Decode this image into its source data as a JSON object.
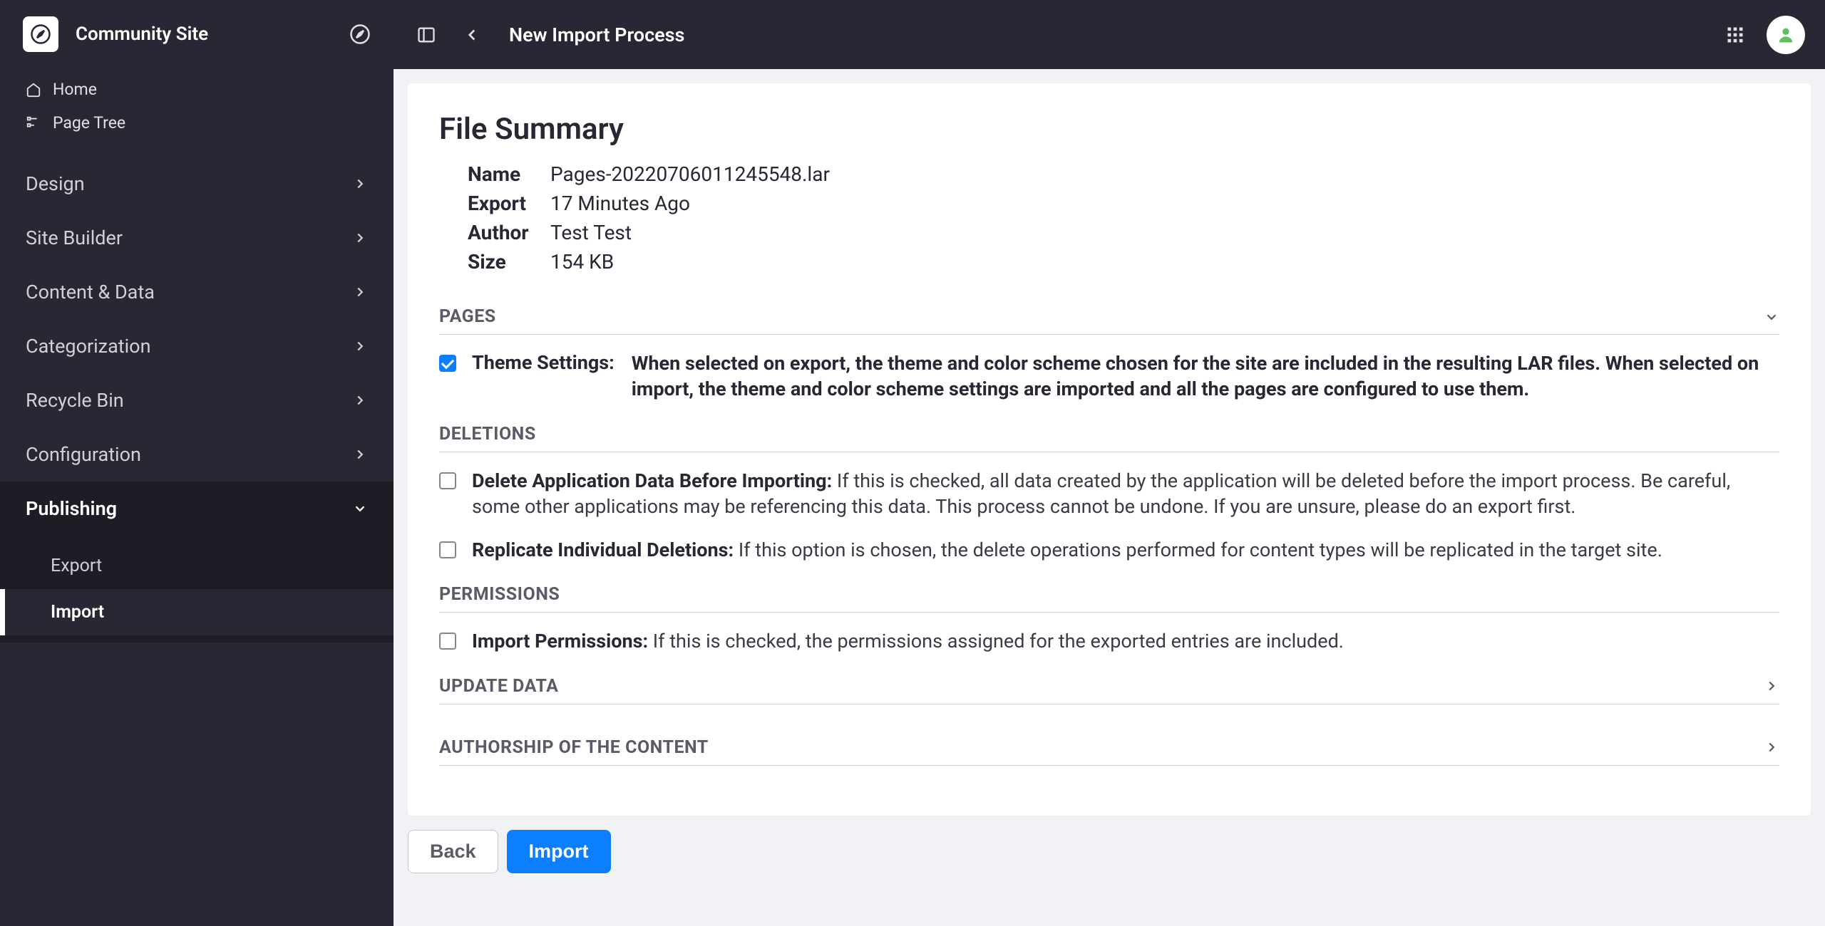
{
  "sidebar": {
    "site_title": "Community Site",
    "quick": [
      {
        "label": "Home"
      },
      {
        "label": "Page Tree"
      }
    ],
    "menu": [
      {
        "label": "Design"
      },
      {
        "label": "Site Builder"
      },
      {
        "label": "Content & Data"
      },
      {
        "label": "Categorization"
      },
      {
        "label": "Recycle Bin"
      },
      {
        "label": "Configuration"
      },
      {
        "label": "Publishing",
        "expanded": true,
        "children": [
          {
            "label": "Export"
          },
          {
            "label": "Import",
            "active": true
          }
        ]
      }
    ]
  },
  "header": {
    "page_title": "New Import Process"
  },
  "summary": {
    "title": "File Summary",
    "rows": {
      "name_k": "Name",
      "name_v": "Pages-20220706011245548.lar",
      "export_k": "Export",
      "export_v": "17 Minutes Ago",
      "author_k": "Author",
      "author_v": "Test Test",
      "size_k": "Size",
      "size_v": "154 KB"
    }
  },
  "sections": {
    "pages": {
      "title": "PAGES",
      "theme_name": "Theme Settings:",
      "theme_desc": "When selected on export, the theme and color scheme chosen for the site are included in the resulting LAR files. When selected on import, the theme and color scheme settings are imported and all the pages are configured to use them."
    },
    "deletions": {
      "title": "DELETIONS",
      "del_app_name": "Delete Application Data Before Importing:",
      "del_app_desc": "If this is checked, all data created by the application will be deleted before the import process. Be careful, some other applications may be referencing this data. This process cannot be undone. If you are unsure, please do an export first.",
      "rep_del_name": "Replicate Individual Deletions:",
      "rep_del_desc": "If this option is chosen, the delete operations performed for content types will be replicated in the target site."
    },
    "permissions": {
      "title": "PERMISSIONS",
      "imp_perm_name": "Import Permissions:",
      "imp_perm_desc": "If this is checked, the permissions assigned for the exported entries are included."
    },
    "update_data": {
      "title": "UPDATE DATA"
    },
    "authorship": {
      "title": "AUTHORSHIP OF THE CONTENT"
    }
  },
  "footer": {
    "back": "Back",
    "import": "Import"
  }
}
